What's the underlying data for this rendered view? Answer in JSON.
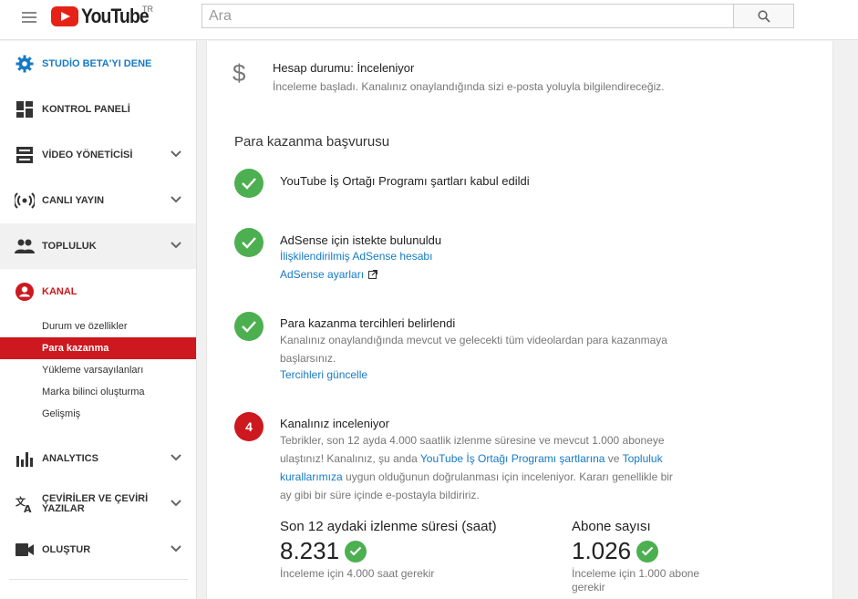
{
  "header": {
    "logo_text": "YouTube",
    "country_code": "TR",
    "search_placeholder": "Ara"
  },
  "sidebar": {
    "items": [
      {
        "label": "STUDİO BETA'YI DENE",
        "icon": "gear-icon",
        "color": "#167ac6"
      },
      {
        "label": "KONTROL PANELİ",
        "icon": "dashboard-icon"
      },
      {
        "label": "VİDEO YÖNETİCİSİ",
        "icon": "video-manager-icon"
      },
      {
        "label": "CANLI YAYIN",
        "icon": "live-icon"
      },
      {
        "label": "TOPLULUK",
        "icon": "community-icon"
      },
      {
        "label": "KANAL",
        "icon": "channel-icon",
        "color": "#cc181e"
      },
      {
        "label": "ANALYTICS",
        "icon": "analytics-icon"
      },
      {
        "label": "ÇEVİRİLER VE ÇEVİRİ YAZILAR",
        "icon": "translate-icon"
      },
      {
        "label": "OLUŞTUR",
        "icon": "create-icon"
      }
    ],
    "kanal_sub": [
      "Durum ve özellikler",
      "Para kazanma",
      "Yükleme varsayılanları",
      "Marka bilinci oluşturma",
      "Gelişmiş"
    ]
  },
  "main": {
    "account": {
      "status": "Hesap durumu: İnceleniyor",
      "desc": "İnceleme başladı. Kanalınız onaylandığında sizi e-posta yoluyla bilgilendireceğiz."
    },
    "section_title": "Para kazanma başvurusu",
    "step1": {
      "title": "YouTube İş Ortağı Programı şartları kabul edildi"
    },
    "step2": {
      "title": "AdSense için istekte bulunuldu",
      "link1": "İlişkilendirilmiş AdSense hesabı",
      "link2": "AdSense ayarları"
    },
    "step3": {
      "title": "Para kazanma tercihleri belirlendi",
      "desc_line1": "Kanalınız onaylandığında mevcut ve gelecekti tüm videolardan para kazanmaya",
      "desc_line2": "başlarsınız.",
      "link": "Tercihleri güncelle"
    },
    "step4": {
      "number": "4",
      "title": "Kanalınız inceleniyor",
      "line1": "Tebrikler, son 12 ayda 4.000 saatlik izlenme süresine ve mevcut 1.000 aboneye",
      "line2_pre": "ulaştınız! Kanalınız, şu anda ",
      "line2_link1": "YouTube İş Ortağı Programı şartlarına",
      "line2_mid": " ve ",
      "line2_link2": "Topluluk",
      "line3_link": "kurallarımıza",
      "line3_post": " uygun olduğunun doğrulanması için inceleniyor. Kararı genellikle bir",
      "line4": "ay gibi bir süre içinde e-postayla bildiririz."
    },
    "metrics": [
      {
        "title": "Son 12 aydaki izlenme süresi (saat)",
        "value": "8.231",
        "note": "İnceleme için 4.000 saat gerekir"
      },
      {
        "title": "Abone sayısı",
        "value": "1.026",
        "note_line1": "İnceleme için 1.000 abone",
        "note_line2": "gerekir"
      }
    ]
  },
  "colors": {
    "accent_blue": "#167ac6",
    "brand_red": "#cc181e",
    "success_green": "#4caf50"
  }
}
